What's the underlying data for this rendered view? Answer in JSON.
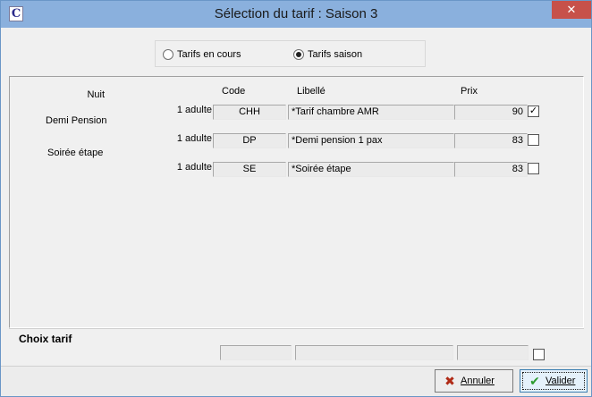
{
  "window": {
    "title": "Sélection du tarif : Saison 3",
    "app_icon_glyph": "C",
    "close_glyph": "✕",
    "title_color": "#8ab0dd",
    "close_color": "#c7514a"
  },
  "mode": {
    "options": [
      {
        "label": "Tarifs en cours",
        "selected": false
      },
      {
        "label": "Tarifs saison",
        "selected": true
      }
    ]
  },
  "categories": [
    "Nuit",
    "Demi Pension",
    "Soirée étape"
  ],
  "table": {
    "headers": {
      "code": "Code",
      "libelle": "Libellé",
      "prix": "Prix"
    },
    "rows": [
      {
        "persons": "1 adulte",
        "code": "CHH",
        "libelle": "*Tarif chambre AMR",
        "prix": "90",
        "checked": true,
        "check_glyph": "✓"
      },
      {
        "persons": "1 adulte",
        "code": "DP",
        "libelle": "*Demi pension 1 pax",
        "prix": "83",
        "checked": false,
        "check_glyph": ""
      },
      {
        "persons": "1 adulte",
        "code": "SE",
        "libelle": "*Soirée étape",
        "prix": "83",
        "checked": false,
        "check_glyph": ""
      }
    ]
  },
  "choix": {
    "label": "Choix tarif",
    "code": "",
    "libelle": "",
    "prix": ""
  },
  "buttons": {
    "annuler": {
      "label": "Annuler",
      "icon": "x-icon",
      "glyph": "✖",
      "color": "#b02a16"
    },
    "valider": {
      "label": "Valider",
      "icon": "check-icon",
      "glyph": "✔",
      "color": "#2e9b2e"
    }
  }
}
